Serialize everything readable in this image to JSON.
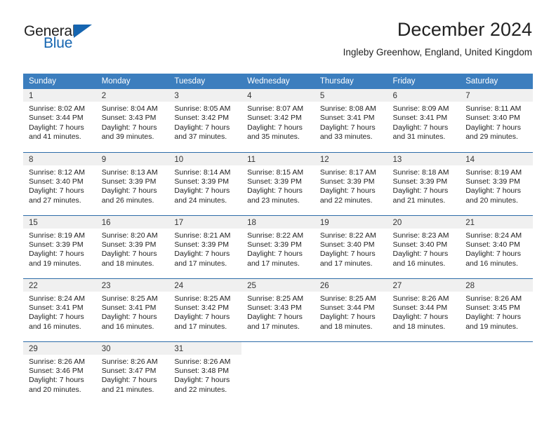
{
  "branding": {
    "name_part1": "General",
    "name_part2": "Blue",
    "accent_color": "#1565b0",
    "triangle_icon": "triangle-icon"
  },
  "header": {
    "title": "December 2024",
    "subtitle": "Ingleby Greenhow, England, United Kingdom"
  },
  "calendar": {
    "header_bg": "#3c7ebe",
    "header_text_color": "#ffffff",
    "daynum_bg": "#f0f0f0",
    "row_divider_color": "#2d6ca8",
    "weekday_headers": [
      "Sunday",
      "Monday",
      "Tuesday",
      "Wednesday",
      "Thursday",
      "Friday",
      "Saturday"
    ],
    "weeks": [
      [
        {
          "day": "1",
          "sunrise": "Sunrise: 8:02 AM",
          "sunset": "Sunset: 3:44 PM",
          "daylight_line1": "Daylight: 7 hours",
          "daylight_line2": "and 41 minutes."
        },
        {
          "day": "2",
          "sunrise": "Sunrise: 8:04 AM",
          "sunset": "Sunset: 3:43 PM",
          "daylight_line1": "Daylight: 7 hours",
          "daylight_line2": "and 39 minutes."
        },
        {
          "day": "3",
          "sunrise": "Sunrise: 8:05 AM",
          "sunset": "Sunset: 3:42 PM",
          "daylight_line1": "Daylight: 7 hours",
          "daylight_line2": "and 37 minutes."
        },
        {
          "day": "4",
          "sunrise": "Sunrise: 8:07 AM",
          "sunset": "Sunset: 3:42 PM",
          "daylight_line1": "Daylight: 7 hours",
          "daylight_line2": "and 35 minutes."
        },
        {
          "day": "5",
          "sunrise": "Sunrise: 8:08 AM",
          "sunset": "Sunset: 3:41 PM",
          "daylight_line1": "Daylight: 7 hours",
          "daylight_line2": "and 33 minutes."
        },
        {
          "day": "6",
          "sunrise": "Sunrise: 8:09 AM",
          "sunset": "Sunset: 3:41 PM",
          "daylight_line1": "Daylight: 7 hours",
          "daylight_line2": "and 31 minutes."
        },
        {
          "day": "7",
          "sunrise": "Sunrise: 8:11 AM",
          "sunset": "Sunset: 3:40 PM",
          "daylight_line1": "Daylight: 7 hours",
          "daylight_line2": "and 29 minutes."
        }
      ],
      [
        {
          "day": "8",
          "sunrise": "Sunrise: 8:12 AM",
          "sunset": "Sunset: 3:40 PM",
          "daylight_line1": "Daylight: 7 hours",
          "daylight_line2": "and 27 minutes."
        },
        {
          "day": "9",
          "sunrise": "Sunrise: 8:13 AM",
          "sunset": "Sunset: 3:39 PM",
          "daylight_line1": "Daylight: 7 hours",
          "daylight_line2": "and 26 minutes."
        },
        {
          "day": "10",
          "sunrise": "Sunrise: 8:14 AM",
          "sunset": "Sunset: 3:39 PM",
          "daylight_line1": "Daylight: 7 hours",
          "daylight_line2": "and 24 minutes."
        },
        {
          "day": "11",
          "sunrise": "Sunrise: 8:15 AM",
          "sunset": "Sunset: 3:39 PM",
          "daylight_line1": "Daylight: 7 hours",
          "daylight_line2": "and 23 minutes."
        },
        {
          "day": "12",
          "sunrise": "Sunrise: 8:17 AM",
          "sunset": "Sunset: 3:39 PM",
          "daylight_line1": "Daylight: 7 hours",
          "daylight_line2": "and 22 minutes."
        },
        {
          "day": "13",
          "sunrise": "Sunrise: 8:18 AM",
          "sunset": "Sunset: 3:39 PM",
          "daylight_line1": "Daylight: 7 hours",
          "daylight_line2": "and 21 minutes."
        },
        {
          "day": "14",
          "sunrise": "Sunrise: 8:19 AM",
          "sunset": "Sunset: 3:39 PM",
          "daylight_line1": "Daylight: 7 hours",
          "daylight_line2": "and 20 minutes."
        }
      ],
      [
        {
          "day": "15",
          "sunrise": "Sunrise: 8:19 AM",
          "sunset": "Sunset: 3:39 PM",
          "daylight_line1": "Daylight: 7 hours",
          "daylight_line2": "and 19 minutes."
        },
        {
          "day": "16",
          "sunrise": "Sunrise: 8:20 AM",
          "sunset": "Sunset: 3:39 PM",
          "daylight_line1": "Daylight: 7 hours",
          "daylight_line2": "and 18 minutes."
        },
        {
          "day": "17",
          "sunrise": "Sunrise: 8:21 AM",
          "sunset": "Sunset: 3:39 PM",
          "daylight_line1": "Daylight: 7 hours",
          "daylight_line2": "and 17 minutes."
        },
        {
          "day": "18",
          "sunrise": "Sunrise: 8:22 AM",
          "sunset": "Sunset: 3:39 PM",
          "daylight_line1": "Daylight: 7 hours",
          "daylight_line2": "and 17 minutes."
        },
        {
          "day": "19",
          "sunrise": "Sunrise: 8:22 AM",
          "sunset": "Sunset: 3:40 PM",
          "daylight_line1": "Daylight: 7 hours",
          "daylight_line2": "and 17 minutes."
        },
        {
          "day": "20",
          "sunrise": "Sunrise: 8:23 AM",
          "sunset": "Sunset: 3:40 PM",
          "daylight_line1": "Daylight: 7 hours",
          "daylight_line2": "and 16 minutes."
        },
        {
          "day": "21",
          "sunrise": "Sunrise: 8:24 AM",
          "sunset": "Sunset: 3:40 PM",
          "daylight_line1": "Daylight: 7 hours",
          "daylight_line2": "and 16 minutes."
        }
      ],
      [
        {
          "day": "22",
          "sunrise": "Sunrise: 8:24 AM",
          "sunset": "Sunset: 3:41 PM",
          "daylight_line1": "Daylight: 7 hours",
          "daylight_line2": "and 16 minutes."
        },
        {
          "day": "23",
          "sunrise": "Sunrise: 8:25 AM",
          "sunset": "Sunset: 3:41 PM",
          "daylight_line1": "Daylight: 7 hours",
          "daylight_line2": "and 16 minutes."
        },
        {
          "day": "24",
          "sunrise": "Sunrise: 8:25 AM",
          "sunset": "Sunset: 3:42 PM",
          "daylight_line1": "Daylight: 7 hours",
          "daylight_line2": "and 17 minutes."
        },
        {
          "day": "25",
          "sunrise": "Sunrise: 8:25 AM",
          "sunset": "Sunset: 3:43 PM",
          "daylight_line1": "Daylight: 7 hours",
          "daylight_line2": "and 17 minutes."
        },
        {
          "day": "26",
          "sunrise": "Sunrise: 8:25 AM",
          "sunset": "Sunset: 3:44 PM",
          "daylight_line1": "Daylight: 7 hours",
          "daylight_line2": "and 18 minutes."
        },
        {
          "day": "27",
          "sunrise": "Sunrise: 8:26 AM",
          "sunset": "Sunset: 3:44 PM",
          "daylight_line1": "Daylight: 7 hours",
          "daylight_line2": "and 18 minutes."
        },
        {
          "day": "28",
          "sunrise": "Sunrise: 8:26 AM",
          "sunset": "Sunset: 3:45 PM",
          "daylight_line1": "Daylight: 7 hours",
          "daylight_line2": "and 19 minutes."
        }
      ],
      [
        {
          "day": "29",
          "sunrise": "Sunrise: 8:26 AM",
          "sunset": "Sunset: 3:46 PM",
          "daylight_line1": "Daylight: 7 hours",
          "daylight_line2": "and 20 minutes."
        },
        {
          "day": "30",
          "sunrise": "Sunrise: 8:26 AM",
          "sunset": "Sunset: 3:47 PM",
          "daylight_line1": "Daylight: 7 hours",
          "daylight_line2": "and 21 minutes."
        },
        {
          "day": "31",
          "sunrise": "Sunrise: 8:26 AM",
          "sunset": "Sunset: 3:48 PM",
          "daylight_line1": "Daylight: 7 hours",
          "daylight_line2": "and 22 minutes."
        },
        {
          "day": "",
          "sunrise": "",
          "sunset": "",
          "daylight_line1": "",
          "daylight_line2": ""
        },
        {
          "day": "",
          "sunrise": "",
          "sunset": "",
          "daylight_line1": "",
          "daylight_line2": ""
        },
        {
          "day": "",
          "sunrise": "",
          "sunset": "",
          "daylight_line1": "",
          "daylight_line2": ""
        },
        {
          "day": "",
          "sunrise": "",
          "sunset": "",
          "daylight_line1": "",
          "daylight_line2": ""
        }
      ]
    ]
  }
}
